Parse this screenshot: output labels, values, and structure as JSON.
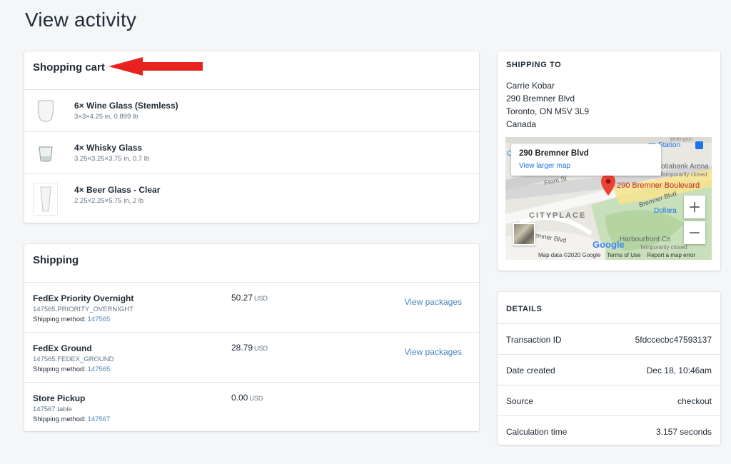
{
  "page": {
    "title": "View activity"
  },
  "cart": {
    "title": "Shopping cart",
    "items": [
      {
        "name": "6× Wine Glass (Stemless)",
        "dims": "3×3×4.25 in, 0.899 lb",
        "icon": "wine-glass-icon"
      },
      {
        "name": "4× Whisky Glass",
        "dims": "3.25×3.25×3.75 in, 0.7 lb",
        "icon": "whisky-glass-icon"
      },
      {
        "name": "4× Beer Glass - Clear",
        "dims": "2.25×2.25×5.75 in, 2 lb",
        "icon": "beer-glass-icon"
      }
    ]
  },
  "shipping": {
    "title": "Shipping",
    "methods": [
      {
        "name": "FedEx Priority Overnight",
        "code": "147565.PRIORITY_OVERNIGHT",
        "method_label": "Shipping method:",
        "method_id": "147565",
        "price": "50.27",
        "currency": "USD",
        "link": "View packages"
      },
      {
        "name": "FedEx Ground",
        "code": "147565.FEDEX_GROUND",
        "method_label": "Shipping method:",
        "method_id": "147565",
        "price": "28.79",
        "currency": "USD",
        "link": "View packages"
      },
      {
        "name": "Store Pickup",
        "code": "147567.table",
        "method_label": "Shipping method:",
        "method_id": "147567",
        "price": "0.00",
        "currency": "USD",
        "link": ""
      }
    ]
  },
  "ship_to": {
    "title": "SHIPPING TO",
    "name": "Carrie Kobar",
    "street": "290 Bremner Blvd",
    "city": "Toronto, ON M5V 3L9",
    "country": "Canada",
    "map": {
      "card_title": "290 Bremner Blvd",
      "card_link": "View larger map",
      "pin_label": "290 Bremner Boulevard",
      "labels": {
        "station": "on Station",
        "arena": "otiabank Arena",
        "closed1": "Temporarily closed",
        "front": "Front St",
        "bremner1": "Bremner Blvd",
        "cityplace": "CITYPLACE",
        "dollar": "Dollara",
        "bremner2": "emner Blvd",
        "harbour": "Harbourfront Ce",
        "closed2": "Temporarily closed",
        "wellington": "Wellington",
        "c": "C"
      },
      "google": "Google",
      "footer": [
        "Map data ©2020 Google",
        "Terms of Use",
        "Report a map error"
      ],
      "zoom_in": "+",
      "zoom_out": "−"
    }
  },
  "details": {
    "title": "DETAILS",
    "rows": [
      {
        "key": "Transaction ID",
        "value": "5fdccecbc47593137"
      },
      {
        "key": "Date created",
        "value": "Dec 18, 10:46am"
      },
      {
        "key": "Source",
        "value": "checkout"
      },
      {
        "key": "Calculation time",
        "value": "3.157 seconds"
      }
    ]
  },
  "colors": {
    "link": "#4a86b8",
    "arrow": "#e8231f",
    "pin": "#ea4335"
  }
}
